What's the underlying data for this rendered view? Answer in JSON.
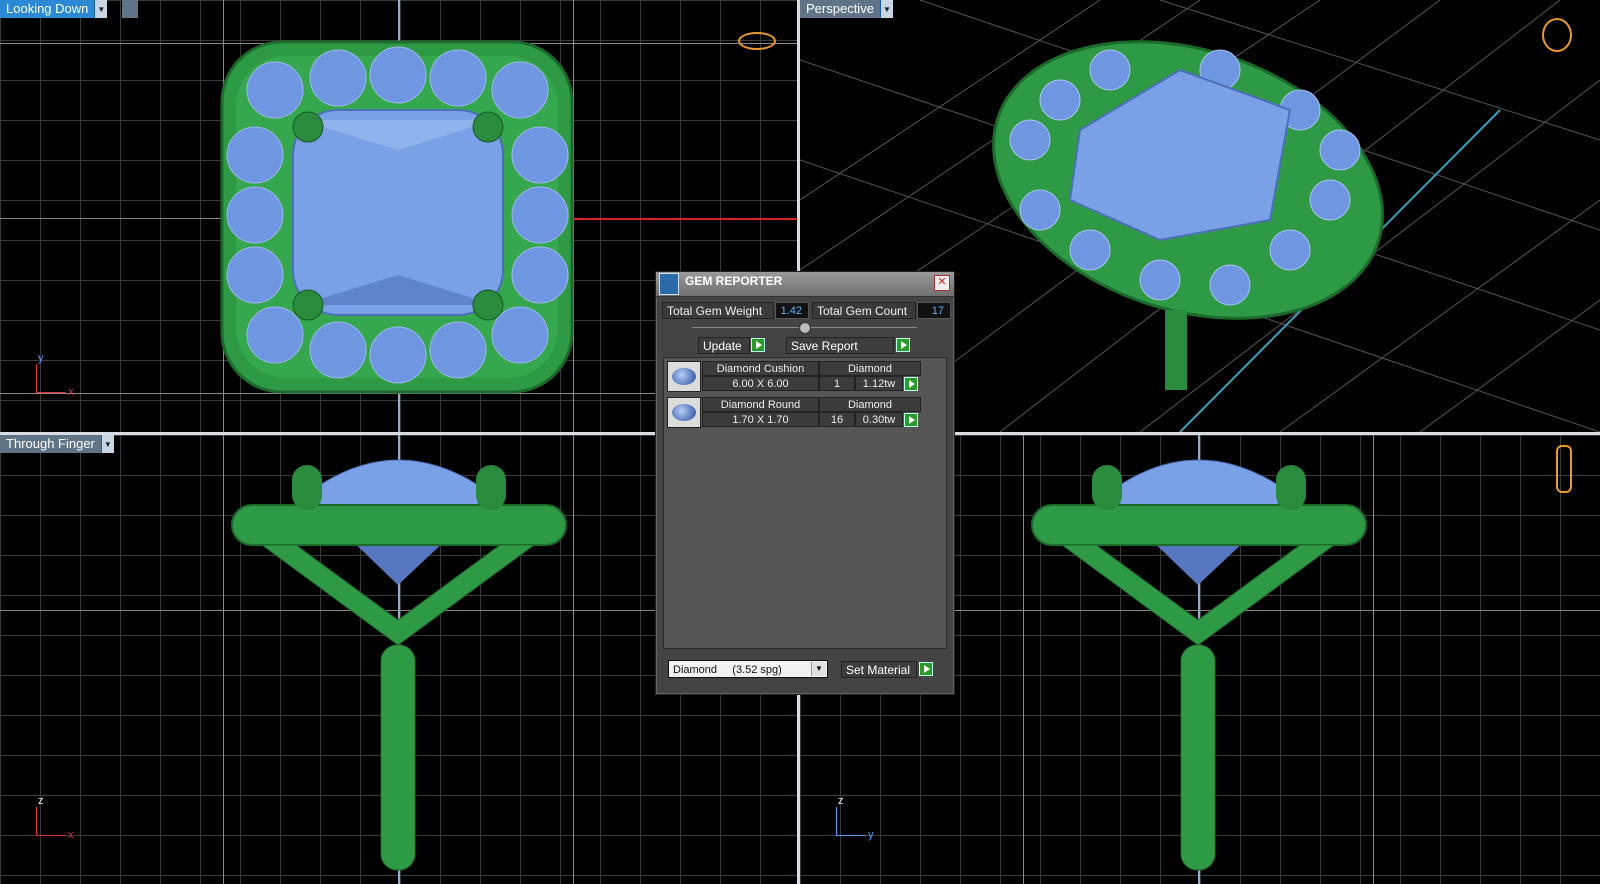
{
  "viewports": {
    "top_left": {
      "label": "Looking Down",
      "axis_v": "y",
      "axis_h": "x"
    },
    "top_right": {
      "label": "Perspective"
    },
    "bottom_left": {
      "label": "Through Finger",
      "axis_v": "z",
      "axis_h": "x"
    },
    "bottom_right": {
      "axis_v": "z",
      "axis_h": "y"
    }
  },
  "dialog": {
    "title": "GEM REPORTER",
    "total_weight_label": "Total Gem Weight",
    "total_weight": "1.42",
    "total_count_label": "Total Gem Count",
    "total_count": "17",
    "update_label": "Update",
    "save_label": "Save Report",
    "gems": [
      {
        "name": "Diamond Cushion",
        "size": "6.00 X 6.00",
        "material": "Diamond",
        "count": "1",
        "weight": "1.12tw"
      },
      {
        "name": "Diamond Round",
        "size": "1.70 X 1.70",
        "material": "Diamond",
        "count": "16",
        "weight": "0.30tw"
      }
    ],
    "material_select": "Diamond     (3.52 spg)",
    "set_material_label": "Set Material"
  },
  "colors": {
    "metal": "#2f9a45",
    "gem": "#6f96e0",
    "label_blue": "#2b89d6"
  }
}
